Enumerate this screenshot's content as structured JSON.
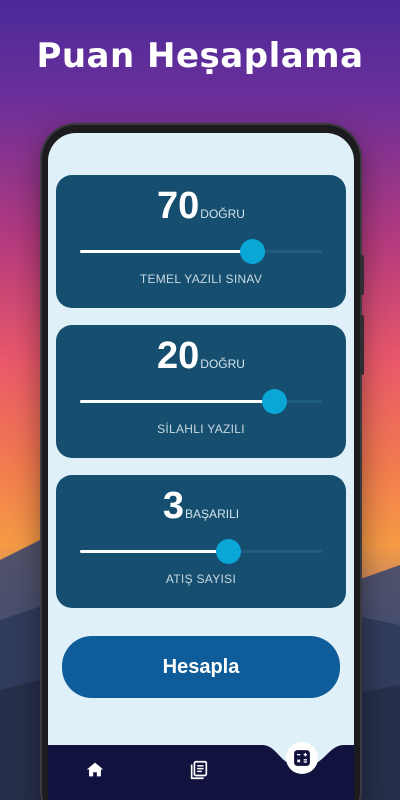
{
  "headline": "Puan Heṣaplama",
  "cards": [
    {
      "value": "70",
      "unit": "DOĞRU",
      "label": "TEMEL YAZILI SINAV",
      "slider_fraction": 0.71
    },
    {
      "value": "20",
      "unit": "DOĞRU",
      "label": "SİLAHLI YAZILI",
      "slider_fraction": 0.8
    },
    {
      "value": "3",
      "unit": "BAŞARILI",
      "label": "ATIŞ SAYISI",
      "slider_fraction": 0.61
    }
  ],
  "calculate_button": "Hesapla",
  "bottom_nav": {
    "items": [
      {
        "icon": "home-icon",
        "active": false
      },
      {
        "icon": "list-icon",
        "active": false
      },
      {
        "icon": "calculator-icon",
        "active": true
      }
    ]
  },
  "colors": {
    "card": "#154e6e",
    "accent": "#0aa6d6",
    "button": "#0e5c99",
    "screen_bg": "#dff0f8",
    "nav_bg": "#12123f"
  }
}
